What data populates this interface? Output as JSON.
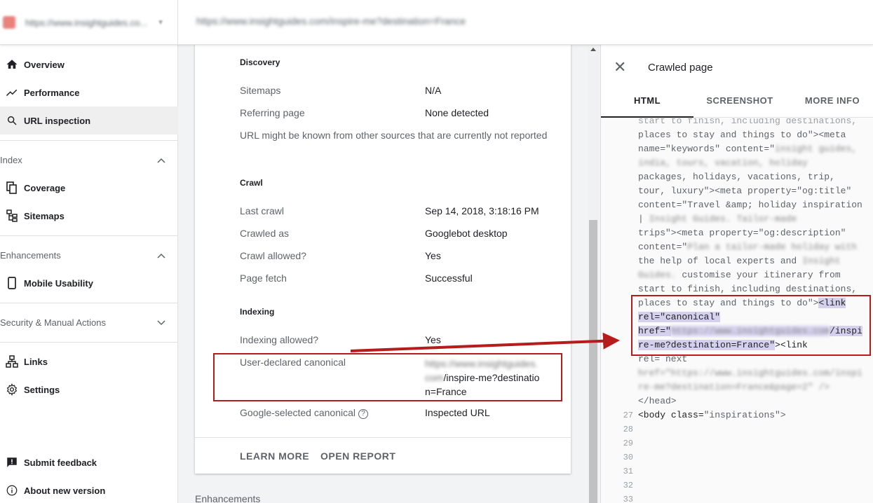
{
  "header": {
    "property_url": "https://www.insightguides.co...",
    "inspected_url": "https://www.insightguides.com/inspire-me?destination=France"
  },
  "sidebar": {
    "items": [
      {
        "label": "Overview",
        "icon": "home-icon"
      },
      {
        "label": "Performance",
        "icon": "trending-up-icon"
      },
      {
        "label": "URL inspection",
        "icon": "search-icon"
      }
    ],
    "sections": {
      "index": {
        "label": "Index",
        "items": [
          "Coverage",
          "Sitemaps"
        ]
      },
      "enhancements": {
        "label": "Enhancements",
        "items": [
          "Mobile Usability"
        ]
      },
      "security": {
        "label": "Security & Manual Actions"
      }
    },
    "other": [
      "Links",
      "Settings"
    ],
    "bottom": [
      "Submit feedback",
      "About new version"
    ]
  },
  "report": {
    "discovery": {
      "title": "Discovery",
      "sitemaps_label": "Sitemaps",
      "sitemaps_value": "N/A",
      "referring_label": "Referring page",
      "referring_value": "None detected",
      "note": "URL might be known from other sources that are currently not reported"
    },
    "crawl": {
      "title": "Crawl",
      "last_crawl_label": "Last crawl",
      "last_crawl_value": "Sep 14, 2018, 3:18:16 PM",
      "crawled_as_label": "Crawled as",
      "crawled_as_value": "Googlebot desktop",
      "crawl_allowed_label": "Crawl allowed?",
      "crawl_allowed_value": "Yes",
      "page_fetch_label": "Page fetch",
      "page_fetch_value": "Successful"
    },
    "indexing": {
      "title": "Indexing",
      "indexing_allowed_label": "Indexing allowed?",
      "indexing_allowed_value": "Yes",
      "user_canonical_label": "User-declared canonical",
      "user_canonical_blur1": "https://www.insightguides.",
      "user_canonical_blur2": "com",
      "user_canonical_line2": "/inspire-me?destinatio",
      "user_canonical_line3": "n=France",
      "google_canonical_label": "Google-selected canonical",
      "google_canonical_help": "?",
      "google_canonical_value": "Inspected URL"
    },
    "footer": {
      "learn_more": "LEARN MORE",
      "open_report": "OPEN REPORT"
    },
    "below_card": "Enhancements"
  },
  "panel": {
    "title": "Crawled page",
    "tabs": [
      "HTML",
      "SCREENSHOT",
      "MORE INFO"
    ],
    "code": {
      "l1": "start to finish, including destinations,",
      "l2a": "places to stay and things to do\"><meta",
      "l3a": "name=\"keywords\" content=\"",
      "l3b": "insight guides,",
      "l4": "india, tours, vacation, holiday",
      "l5": "packages, holidays, vacations, trip,",
      "l6": "tour, luxury\"><meta property=\"og:title\"",
      "l7": "content=\"Travel &amp; holiday inspiration",
      "l8a": "|",
      "l8b": "Insight Guides. Tailor-made",
      "l9": "trips\"><meta property=\"og:description\"",
      "l10a": "content=\"",
      "l10b": "Plan a tailor-made holiday with",
      "l11a": "the help of local experts and",
      "l11b": "Insight",
      "l12a": "Guides.",
      "l12b": " customise your itinerary from",
      "l13": "start to finish, including destinations,",
      "l14a": "places to stay and things to do\">",
      "l14b": "<link",
      "l15": "rel=\"canonical\"",
      "l16a": "href=\"",
      "l16b": "https://www.insightguides.com",
      "l16c": "/inspi",
      "l17a": "re-me?destination=France\"",
      "l17b": "><link",
      "l18": "rel= next",
      "l19": "href=\"https://www.insightguides.com/inspi",
      "l20": "re-me?destination=France&page=2\" />",
      "l21": "</head>",
      "l22a": "<body ",
      "l22b": "class=",
      "l22c": "\"inspirations\">",
      "line_numbers": [
        "27",
        "28",
        "29",
        "30",
        "31",
        "32",
        "33"
      ]
    }
  },
  "colors": {
    "highlight": "#d4d0ee",
    "annotation_red": "#b71c1c"
  }
}
